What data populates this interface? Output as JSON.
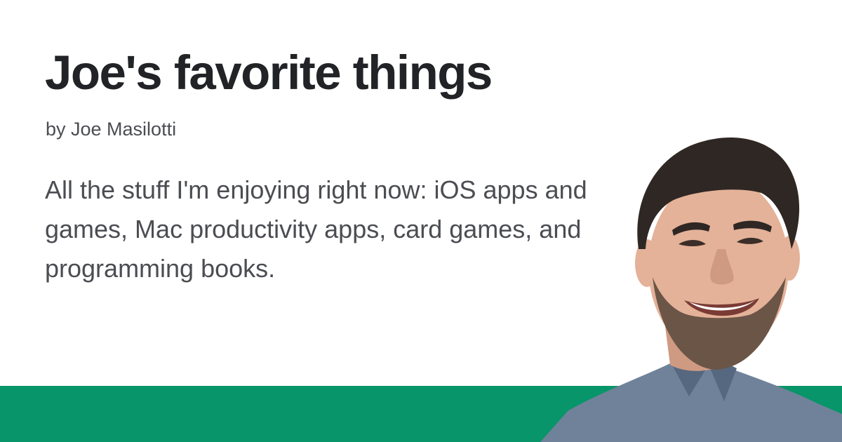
{
  "page": {
    "title": "Joe's favorite things",
    "byline": "by Joe Masilotti",
    "description": "All the stuff I'm enjoying right now: iOS apps and games, Mac productivity apps, card games, and programming books."
  },
  "colors": {
    "background": "#ffffff",
    "title": "#222326",
    "body_text": "#4b4d52",
    "band_green": "#089569",
    "shirt": "#6f829a",
    "hair": "#2f2723",
    "skin": "#e4b299",
    "beard": "#6b5547"
  },
  "icons": {
    "portrait": "author-portrait"
  }
}
